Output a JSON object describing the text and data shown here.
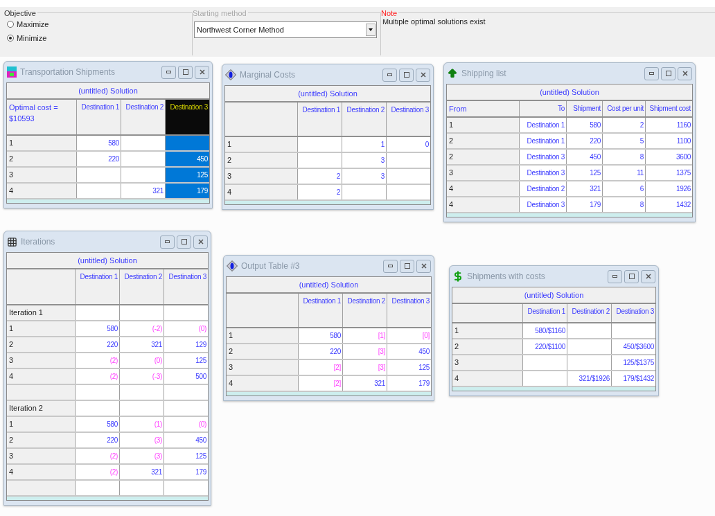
{
  "objective": {
    "title": "Objective",
    "options": [
      {
        "label": "Maximize",
        "selected": false
      },
      {
        "label": "Minimize",
        "selected": true
      }
    ]
  },
  "starting_method": {
    "title": "Starting method",
    "value": "Northwest Corner Method"
  },
  "note": {
    "title": "Note",
    "text": "Multiple optimal solutions exist"
  },
  "windows": [
    {
      "title": "Transportation Shipments",
      "table": {
        "caption": "(untitled) Solution",
        "corner": "Optimal cost = $10593",
        "columns": [
          {
            "label": "Destination 1",
            "selected": false
          },
          {
            "label": "Destination 2",
            "selected": false
          },
          {
            "label": "Destination 3",
            "selected": true
          }
        ],
        "rows": [
          {
            "label": "1",
            "cells": [
              "580",
              null,
              null
            ]
          },
          {
            "label": "2",
            "cells": [
              "220",
              null,
              "450"
            ]
          },
          {
            "label": "3",
            "cells": [
              null,
              null,
              "125"
            ]
          },
          {
            "label": "4",
            "cells": [
              null,
              "321",
              "179"
            ]
          }
        ]
      }
    },
    {
      "title": "Marginal Costs",
      "table": {
        "caption": "(untitled) Solution",
        "columns": [
          "Destination 1",
          "Destination 2",
          "Destination 3"
        ],
        "rows": [
          {
            "label": "1",
            "cells": [
              null,
              "1",
              "0"
            ]
          },
          {
            "label": "2",
            "cells": [
              null,
              "3",
              null
            ]
          },
          {
            "label": "3",
            "cells": [
              "2",
              "3",
              null
            ]
          },
          {
            "label": "4",
            "cells": [
              "2",
              null,
              null
            ]
          }
        ]
      }
    },
    {
      "title": "Shipping list",
      "table": {
        "caption": "(untitled) Solution",
        "corner": "From",
        "columns": [
          "To",
          "Shipment",
          "Cost per unit",
          "Shipment cost"
        ],
        "rows": [
          {
            "label": "1",
            "cells": [
              "Destination 1",
              "580",
              "2",
              "1160"
            ]
          },
          {
            "label": "2",
            "cells": [
              "Destination 1",
              "220",
              "5",
              "1100"
            ]
          },
          {
            "label": "2",
            "cells": [
              "Destination 3",
              "450",
              "8",
              "3600"
            ]
          },
          {
            "label": "3",
            "cells": [
              "Destination 3",
              "125",
              "11",
              "1375"
            ]
          },
          {
            "label": "4",
            "cells": [
              "Destination 2",
              "321",
              "6",
              "1926"
            ]
          },
          {
            "label": "4",
            "cells": [
              "Destination 3",
              "179",
              "8",
              "1432"
            ]
          }
        ]
      }
    },
    {
      "title": "Iterations",
      "table": {
        "caption": "(untitled) Solution",
        "columns": [
          "Destination 1",
          "Destination 2",
          "Destination 3"
        ],
        "rows": [
          {
            "label": "Iteration 1",
            "cells": [
              null,
              null,
              null
            ]
          },
          {
            "label": "1",
            "cells": [
              {
                "text": "580",
                "kind": "basic"
              },
              {
                "text": "(-2)",
                "kind": "nonbasic"
              },
              {
                "text": "(0)",
                "kind": "nonbasic"
              }
            ]
          },
          {
            "label": "2",
            "cells": [
              {
                "text": "220",
                "kind": "basic"
              },
              {
                "text": "321",
                "kind": "basic"
              },
              {
                "text": "129",
                "kind": "basic"
              }
            ]
          },
          {
            "label": "3",
            "cells": [
              {
                "text": "(2)",
                "kind": "nonbasic"
              },
              {
                "text": "(0)",
                "kind": "nonbasic"
              },
              {
                "text": "125",
                "kind": "basic"
              }
            ]
          },
          {
            "label": "4",
            "cells": [
              {
                "text": "(2)",
                "kind": "nonbasic"
              },
              {
                "text": "(-3)",
                "kind": "nonbasic"
              },
              {
                "text": "500",
                "kind": "basic"
              }
            ]
          },
          {
            "cells": [
              null,
              null,
              null
            ]
          },
          {
            "label": "Iteration 2",
            "cells": [
              null,
              null,
              null
            ]
          },
          {
            "label": "1",
            "cells": [
              {
                "text": "580",
                "kind": "basic"
              },
              {
                "text": "(1)",
                "kind": "nonbasic"
              },
              {
                "text": "(0)",
                "kind": "nonbasic"
              }
            ]
          },
          {
            "label": "2",
            "cells": [
              {
                "text": "220",
                "kind": "basic"
              },
              {
                "text": "(3)",
                "kind": "nonbasic"
              },
              {
                "text": "450",
                "kind": "basic"
              }
            ]
          },
          {
            "label": "3",
            "cells": [
              {
                "text": "(2)",
                "kind": "nonbasic"
              },
              {
                "text": "(3)",
                "kind": "nonbasic"
              },
              {
                "text": "125",
                "kind": "basic"
              }
            ]
          },
          {
            "label": "4",
            "cells": [
              {
                "text": "(2)",
                "kind": "nonbasic"
              },
              {
                "text": "321",
                "kind": "basic"
              },
              {
                "text": "179",
                "kind": "basic"
              }
            ]
          },
          {
            "cells": [
              null,
              null,
              null
            ]
          }
        ]
      }
    },
    {
      "title": "Output Table #3",
      "table": {
        "caption": "(untitled) Solution",
        "columns": [
          "Destination 1",
          "Destination 2",
          "Destination 3"
        ],
        "rows": [
          {
            "label": "1",
            "cells": [
              {
                "text": "580",
                "kind": "basic"
              },
              {
                "text": "[1]",
                "kind": "nonbasic"
              },
              {
                "text": "[0]",
                "kind": "nonbasic"
              }
            ]
          },
          {
            "label": "2",
            "cells": [
              {
                "text": "220",
                "kind": "basic"
              },
              {
                "text": "[3]",
                "kind": "nonbasic"
              },
              {
                "text": "450",
                "kind": "basic"
              }
            ]
          },
          {
            "label": "3",
            "cells": [
              {
                "text": "[2]",
                "kind": "nonbasic"
              },
              {
                "text": "[3]",
                "kind": "nonbasic"
              },
              {
                "text": "125",
                "kind": "basic"
              }
            ]
          },
          {
            "label": "4",
            "cells": [
              {
                "text": "[2]",
                "kind": "nonbasic"
              },
              {
                "text": "321",
                "kind": "basic"
              },
              {
                "text": "179",
                "kind": "basic"
              }
            ]
          }
        ]
      }
    },
    {
      "title": "Shipments with costs",
      "table": {
        "caption": "(untitled) Solution",
        "columns": [
          "Destination 1",
          "Destination 2",
          "Destination 3"
        ],
        "rows": [
          {
            "label": "1",
            "cells": [
              "580/$1160",
              null,
              null
            ]
          },
          {
            "label": "2",
            "cells": [
              "220/$1100",
              null,
              "450/$3600"
            ]
          },
          {
            "label": "3",
            "cells": [
              null,
              null,
              "125/$1375"
            ]
          },
          {
            "label": "4",
            "cells": [
              null,
              "321/$1926",
              "179/$1432"
            ]
          }
        ]
      }
    }
  ]
}
